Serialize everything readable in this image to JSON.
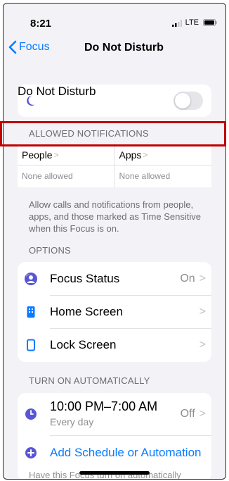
{
  "status": {
    "time": "8:21",
    "network": "LTE"
  },
  "nav": {
    "back_label": "Focus",
    "title": "Do Not Disturb"
  },
  "dnd": {
    "label": "Do Not Disturb",
    "enabled": false
  },
  "allowed": {
    "header": "ALLOWED NOTIFICATIONS",
    "people": {
      "label": "People",
      "value": "None allowed"
    },
    "apps": {
      "label": "Apps",
      "value": "None allowed"
    },
    "description": "Allow calls and notifications from people, apps, and those marked as Time Sensitive when this Focus is on."
  },
  "options": {
    "header": "OPTIONS",
    "items": [
      {
        "label": "Focus Status",
        "value": "On",
        "icon": "focus-status-icon"
      },
      {
        "label": "Home Screen",
        "value": "",
        "icon": "home-screen-icon"
      },
      {
        "label": "Lock Screen",
        "value": "",
        "icon": "lock-screen-icon"
      }
    ]
  },
  "auto": {
    "header": "TURN ON AUTOMATICALLY",
    "schedule": {
      "time": "10:00 PM–7:00 AM",
      "days": "Every day",
      "value": "Off"
    },
    "add_label": "Add Schedule or Automation",
    "footer": "Have this Focus turn on automatically"
  },
  "colors": {
    "accent": "#0a7aff",
    "moon": "#5856d6",
    "highlight": "#c00000"
  }
}
